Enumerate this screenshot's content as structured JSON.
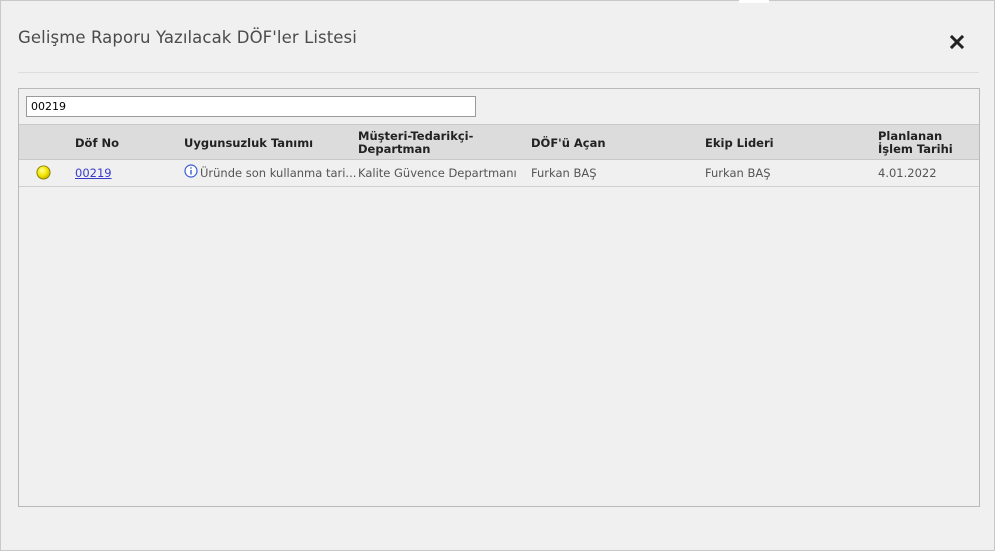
{
  "dialog": {
    "title": "Gelişme Raporu Yazılacak DÖF'ler Listesi",
    "close_icon": "close-icon"
  },
  "search": {
    "value": "00219"
  },
  "table": {
    "columns": [
      {
        "key": "status",
        "label": ""
      },
      {
        "key": "dof_no",
        "label": "Döf No"
      },
      {
        "key": "nonconformity",
        "label": "Uygunsuzluk Tanımı"
      },
      {
        "key": "department",
        "label": "Müşteri-Tedarikçi-Departman"
      },
      {
        "key": "opened_by",
        "label": "DÖF'ü Açan"
      },
      {
        "key": "team_leader",
        "label": "Ekip Lideri"
      },
      {
        "key": "planned_date",
        "label": "Planlanan İşlem Tarihi"
      }
    ],
    "headers": {
      "dof_no": "Döf No",
      "nonconformity": "Uygunsuzluk Tanımı",
      "department_line1": "Müşteri-Tedarikçi-",
      "department_line2": "Departman",
      "opened_by": "DÖF'ü Açan",
      "team_leader": "Ekip Lideri",
      "planned_date_line1": "Planlanan",
      "planned_date_line2": "İşlem Tarihi"
    },
    "rows": [
      {
        "status_icon": "yellow-status-dot",
        "status_color": "#f4e600",
        "dof_no": "00219",
        "info_icon": "info-icon",
        "nonconformity": "Üründe son kullanma tari...",
        "department": "Kalite Güvence Departmanı",
        "opened_by": "Furkan BAŞ",
        "team_leader": "Furkan BAŞ",
        "planned_date": "4.01.2022"
      }
    ]
  },
  "colors": {
    "background": "#f0f0f0",
    "header_bg": "#dcdcdc",
    "link": "#3a3acb",
    "info_icon": "#3b5bd6"
  }
}
